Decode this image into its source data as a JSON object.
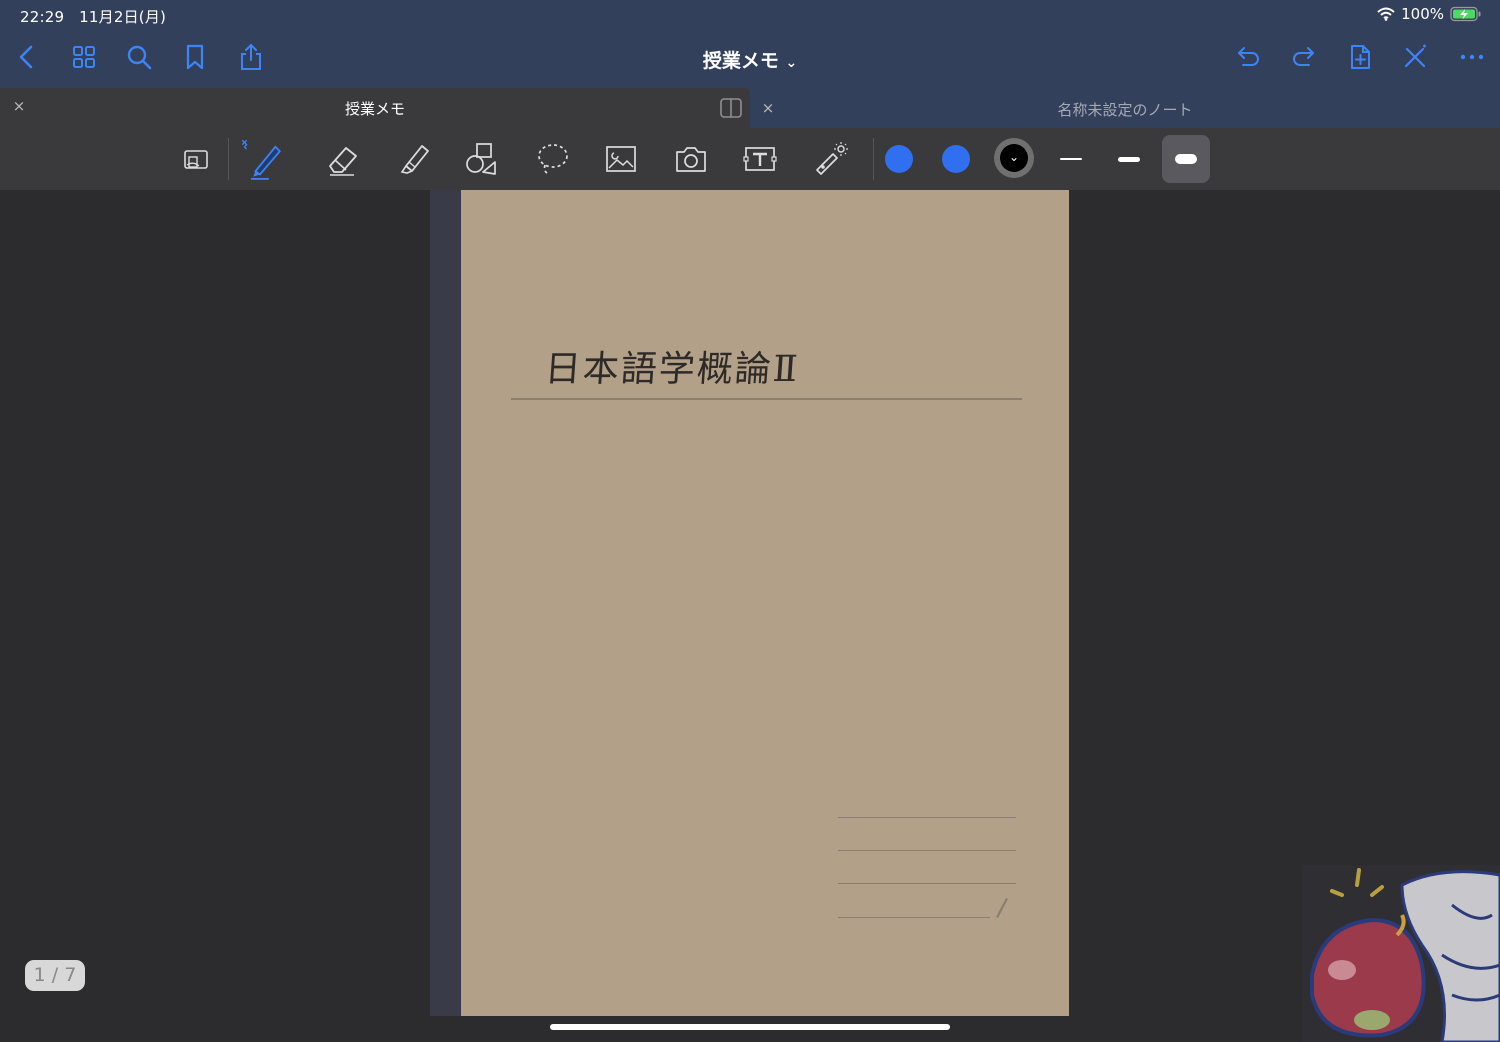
{
  "status": {
    "time": "22:29",
    "date": "11月2日(月)",
    "battery": "100%"
  },
  "nav": {
    "title": "授業メモ",
    "title_chevron": "⌄"
  },
  "tabs": [
    {
      "label": "授業メモ",
      "close": "×",
      "active": true
    },
    {
      "label": "名称未設定のノート",
      "close": "×",
      "active": false
    }
  ],
  "toolbar": {
    "tools": [
      "zoom-window-icon",
      "pen-icon",
      "eraser-icon",
      "highlighter-icon",
      "shapes-icon",
      "lasso-icon",
      "image-icon",
      "camera-icon",
      "text-icon",
      "laser-pointer-icon"
    ],
    "colors": [
      "#2f6ff0",
      "#2f6ff0",
      "#000000"
    ],
    "sizes": [
      "thin",
      "medium",
      "thick"
    ]
  },
  "page": {
    "handwritten_title": "日本語学概論Ⅱ",
    "paper_color": "#b2a088"
  },
  "page_indicator": "1 / 7",
  "colors": {
    "accent": "#3d84f5",
    "navbar": "#33405c",
    "toolbar": "#3a3a3c",
    "background": "#2c2c2e"
  }
}
